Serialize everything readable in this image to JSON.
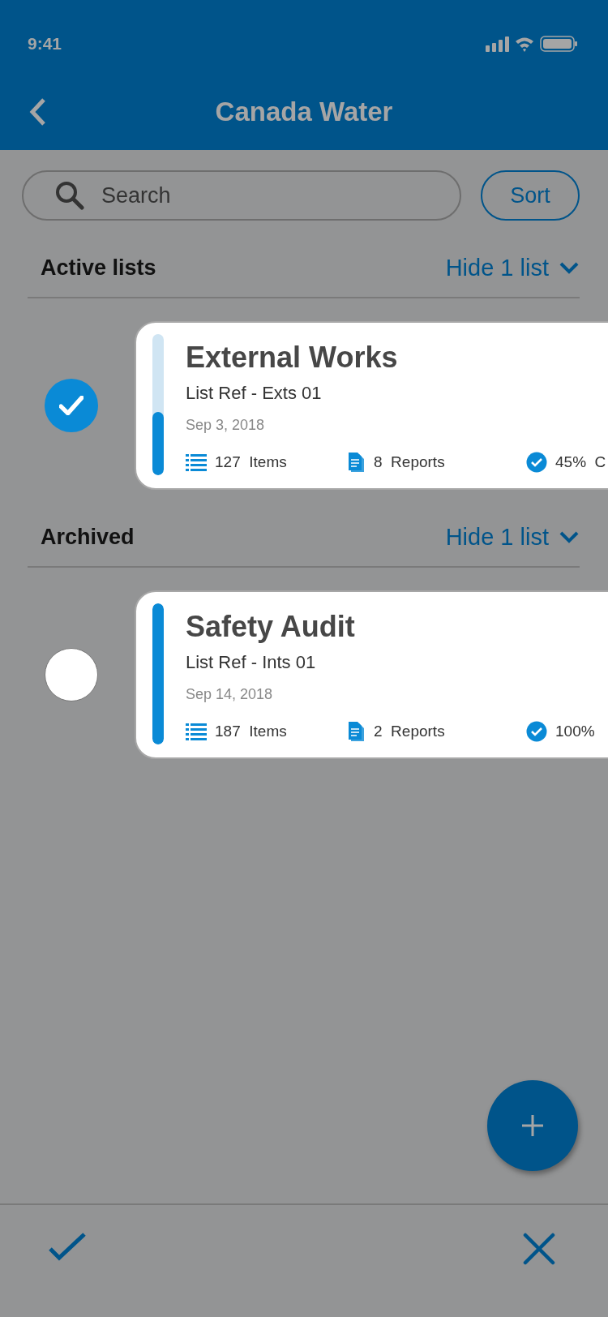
{
  "status_bar": {
    "time": "9:41"
  },
  "header": {
    "title": "Canada Water"
  },
  "search": {
    "placeholder": "Search"
  },
  "sort_button": {
    "label": "Sort"
  },
  "sections": [
    {
      "title": "Active lists",
      "toggle": "Hide 1 list",
      "lists": [
        {
          "title": "External Works",
          "ref": "List Ref - Exts 01",
          "date": "Sep 3, 2018",
          "selected": true,
          "level": 0.45,
          "items": "127",
          "items_label": "Items",
          "reports": "8",
          "reports_label": "Reports",
          "complete": "45%",
          "complete_label": "C"
        }
      ]
    },
    {
      "title": "Archived",
      "toggle": "Hide 1 list",
      "lists": [
        {
          "title": "Safety Audit",
          "ref": "List Ref - Ints 01",
          "date": "Sep 14, 2018",
          "selected": false,
          "level": 1,
          "items": "187",
          "items_label": "Items",
          "reports": "2",
          "reports_label": "Reports",
          "complete": "100%"
        }
      ]
    }
  ]
}
